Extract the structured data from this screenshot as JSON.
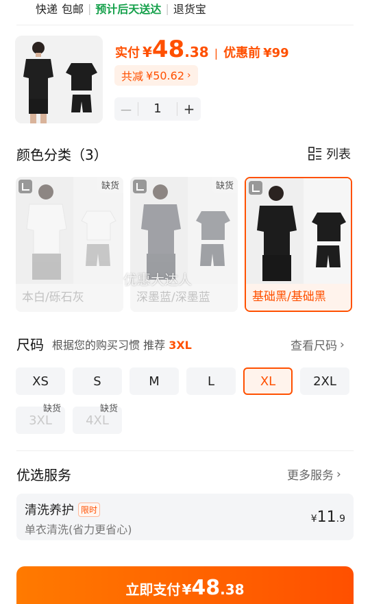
{
  "delivery": {
    "method": "快递",
    "shipping": "包邮",
    "eta": "预计后天送达",
    "return_service": "退货宝"
  },
  "product": {
    "pay_label": "实付",
    "currency": "¥",
    "price_int": "48",
    "price_dec": ".38",
    "before_label": "优惠前",
    "before_price": "¥99",
    "discount_label": "共减",
    "discount_value": "¥50.62",
    "quantity": "1",
    "minus": "－",
    "plus": "+"
  },
  "colors": {
    "title": "颜色分类（3）",
    "list_label": "列表",
    "out_of_stock": "缺货",
    "items": [
      {
        "label": "本白/砾石灰",
        "out_of_stock": true,
        "selected": false
      },
      {
        "label": "深墨蓝/深墨蓝",
        "out_of_stock": true,
        "selected": false
      },
      {
        "label": "基础黑/基础黑",
        "out_of_stock": false,
        "selected": true
      }
    ]
  },
  "watermark": "优惠大达人",
  "size": {
    "title": "尺码",
    "hint_prefix": "根据您的购买习惯 推荐",
    "recommended": "3XL",
    "view_size": "查看尺码",
    "out_of_stock": "缺货",
    "options": [
      {
        "label": "XS",
        "state": "normal"
      },
      {
        "label": "S",
        "state": "normal"
      },
      {
        "label": "M",
        "state": "normal"
      },
      {
        "label": "L",
        "state": "normal"
      },
      {
        "label": "XL",
        "state": "selected"
      },
      {
        "label": "2XL",
        "state": "normal"
      },
      {
        "label": "3XL",
        "state": "disabled"
      },
      {
        "label": "4XL",
        "state": "disabled"
      }
    ]
  },
  "service": {
    "title": "优选服务",
    "more": "更多服务",
    "item_name": "清洗养护",
    "item_tag": "限时",
    "item_desc": "单衣清洗(省力更省心)",
    "price_currency": "¥",
    "price_int": "11",
    "price_dec": ".9"
  },
  "pay_button": {
    "label": "立即支付",
    "currency": "¥",
    "price_int": "48",
    "price_dec": ".38"
  },
  "colors_theme": {
    "accent": "#ff5000",
    "green": "#14a04a"
  }
}
